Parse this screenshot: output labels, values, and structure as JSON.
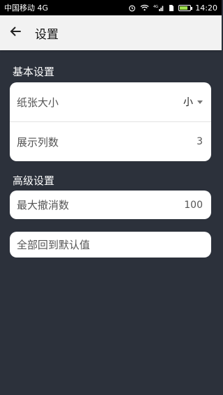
{
  "status_bar": {
    "carrier": "中国移动 4G",
    "time": "14:20",
    "icons": [
      "alarm-icon",
      "wifi-icon",
      "signal-icon",
      "sim-icon",
      "battery-icon"
    ],
    "network_label": "4G"
  },
  "app_bar": {
    "title": "设置",
    "back_icon": "arrow-left-icon"
  },
  "sections": {
    "basic": {
      "title": "基本设置",
      "paper_size_label": "纸张大小",
      "paper_size_value": "小",
      "display_columns_label": "展示列数",
      "display_columns_value": "3"
    },
    "advanced": {
      "title": "高级设置",
      "max_undo_label": "最大撤消数",
      "max_undo_value": "100",
      "reset_label": "全部回到默认值"
    }
  },
  "colors": {
    "background": "#2c313b",
    "card": "#ffffff",
    "app_bar": "#f2f2f2"
  }
}
